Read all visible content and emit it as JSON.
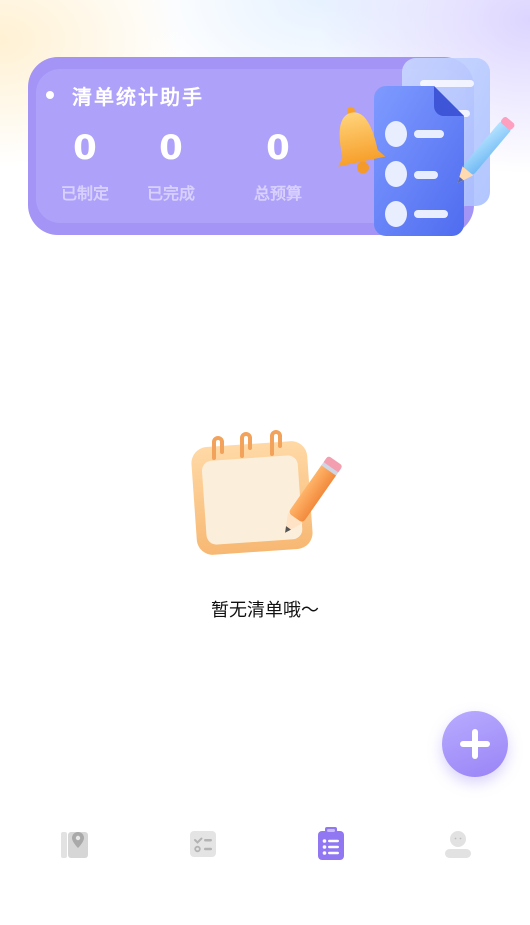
{
  "stats_card": {
    "title": "清单统计助手",
    "stats": [
      {
        "value": "0",
        "label": "已制定"
      },
      {
        "value": "0",
        "label": "已完成"
      },
      {
        "value": "0",
        "label": "总预算"
      }
    ],
    "illustration": "checklist-bell-pencil-illustration"
  },
  "empty_state": {
    "icon": "notepad-pencil-icon",
    "text": "暂无清单哦～"
  },
  "fab": {
    "icon": "plus-icon",
    "color": "#a897f8"
  },
  "tabbar": {
    "tabs": [
      {
        "icon": "map-pin-icon",
        "active": false
      },
      {
        "icon": "checklist-icon",
        "active": false
      },
      {
        "icon": "clipboard-list-icon",
        "active": true
      },
      {
        "icon": "user-icon",
        "active": false
      }
    ],
    "active_color": "#9177f1",
    "inactive_color": "#d8d8d8"
  }
}
